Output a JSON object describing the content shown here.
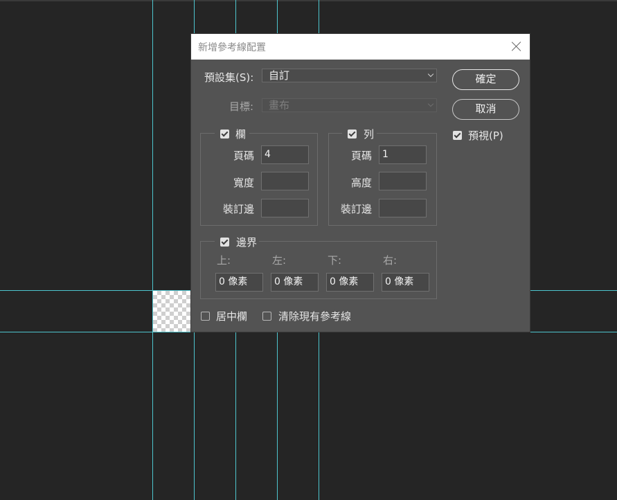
{
  "dialog": {
    "title": "新增參考線配置",
    "preset_label": "預設集(S):",
    "preset_value": "自訂",
    "target_label": "目標:",
    "target_value": "畫布",
    "ok_button": "確定",
    "cancel_button": "取消",
    "preview": {
      "label": "預視(P)",
      "checked": true
    },
    "columns": {
      "label": "欄",
      "checked": true,
      "number_label": "頁碼",
      "number_value": "4",
      "width_label": "寬度",
      "width_value": "",
      "gutter_label": "裝訂邊",
      "gutter_value": ""
    },
    "rows": {
      "label": "列",
      "checked": true,
      "number_label": "頁碼",
      "number_value": "1",
      "height_label": "高度",
      "height_value": "",
      "gutter_label": "裝訂邊",
      "gutter_value": ""
    },
    "margin": {
      "label": "邊界",
      "checked": true,
      "top_label": "上:",
      "left_label": "左:",
      "bottom_label": "下:",
      "right_label": "右:",
      "top_value": "0 像素",
      "left_value": "0 像素",
      "bottom_value": "0 像素",
      "right_value": "0 像素"
    },
    "center_columns": {
      "label": "居中欄",
      "checked": false
    },
    "clear_guides": {
      "label": "清除現有參考線",
      "checked": false
    }
  },
  "colors": {
    "canvas_bg": "#252525",
    "dialog_bg": "#535353",
    "guide": "#4ec6cf"
  },
  "icons": [
    "close-icon",
    "chevron-down-icon",
    "checkbox-checked-icon",
    "checkbox-unchecked-icon"
  ]
}
